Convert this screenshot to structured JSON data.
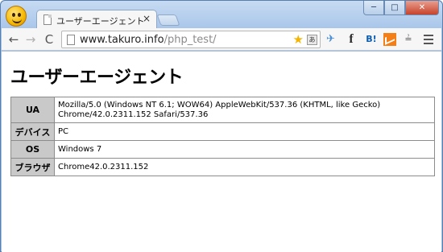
{
  "tab": {
    "title": "ユーザーエージェント",
    "close": "×"
  },
  "window_controls": {
    "minimize": "─",
    "maximize": "□",
    "close": "✕"
  },
  "toolbar": {
    "back": "←",
    "forward": "→",
    "reload": "C",
    "url_host": "www.takuro.info",
    "url_path": "/php_test/",
    "star": "★",
    "translate": "あ",
    "ext_bird": "✈",
    "ext_facebook": "f",
    "ext_hatena": "B!",
    "ext_scale": "≟"
  },
  "icons": [
    "app-logo",
    "document-icon",
    "star-icon",
    "translate-icon",
    "bird-extension-icon",
    "facebook-icon",
    "hatena-bookmark-icon",
    "analytics-icon",
    "menu-icon"
  ],
  "page": {
    "title": "ユーザーエージェント",
    "rows": [
      {
        "label": "UA",
        "value": "Mozilla/5.0 (Windows NT 6.1; WOW64) AppleWebKit/537.36 (KHTML, like Gecko) Chrome/42.0.2311.152 Safari/537.36"
      },
      {
        "label": "デバイス",
        "value": "PC"
      },
      {
        "label": "OS",
        "value": "Windows 7"
      },
      {
        "label": "ブラウザ",
        "value": "Chrome42.0.2311.152"
      }
    ]
  },
  "colors": {
    "frame": "#9fc0e6",
    "header_cell": "#c9c9c9",
    "url_path": "#8a8a8a"
  }
}
